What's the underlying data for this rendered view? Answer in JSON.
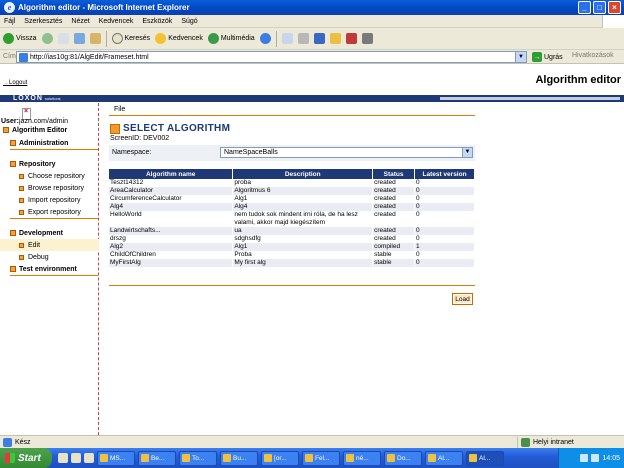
{
  "window": {
    "title": "Algorithm editor - Microsoft Internet Explorer"
  },
  "menubar": [
    "Fájl",
    "Szerkesztés",
    "Nézet",
    "Kedvencek",
    "Eszközök",
    "Súgó"
  ],
  "toolbar": {
    "back": "Vissza",
    "search": "Keresés",
    "favorites": "Kedvencek",
    "media": "Multimédia"
  },
  "address": {
    "label": "Cím",
    "url": "http://ias10g:81/AlgEdit/Frameset.html",
    "go": "Ugrás",
    "links": "Hivatkozások"
  },
  "app": {
    "logout": "Logout",
    "title": "Algorithm editor",
    "brand": "LOXON",
    "brand_sub": "solutions"
  },
  "user": {
    "label": "User:",
    "value": "jazn.com/admin"
  },
  "tree": {
    "root": "Algorithm Editor",
    "groups": [
      {
        "label": "Administration",
        "items": []
      },
      {
        "label": "Repository",
        "items": [
          "Choose repository",
          "Browse repository",
          "Import repository",
          "Export repository"
        ]
      },
      {
        "label": "Development",
        "items": [
          "Edit",
          "Debug"
        ]
      },
      {
        "label": "Test environment",
        "items": []
      }
    ],
    "active_item": "Edit"
  },
  "main": {
    "file_menu": "File",
    "section_title": "SELECT ALGORITHM",
    "screen_id": "ScreenID: DEV002",
    "namespace_label": "Namespace:",
    "namespace_value": "NameSpaceBalls",
    "load_button": "Load"
  },
  "table": {
    "headers": [
      "Algorithm name",
      "Description",
      "Status",
      "Latest version"
    ],
    "rows": [
      [
        "Teszt14312",
        "proba",
        "created",
        "0"
      ],
      [
        "AreaCalculator",
        "Algoritmus 6",
        "created",
        "0"
      ],
      [
        "CircumferenceCalculator",
        "Alg1",
        "created",
        "0"
      ],
      [
        "Alg4",
        "Alg4",
        "created",
        "0"
      ],
      [
        "HelloWorld",
        "nem tudok sok mindent irni róla, de ha lesz valami, akkor majd kiegészítem",
        "created",
        "0"
      ],
      [
        "Landwirtschafts...",
        "ua",
        "created",
        "0"
      ],
      [
        "drszg",
        "sdghsdfg",
        "created",
        "0"
      ],
      [
        "Alg2",
        "Alg1",
        "compiled",
        "1"
      ],
      [
        "ChildOfChildren",
        "Proba",
        "stable",
        "0"
      ],
      [
        "MyFirstAlg",
        "My first alg",
        "stable",
        "0"
      ]
    ]
  },
  "status": {
    "text": "Kész",
    "zone": "Helyi intranet"
  },
  "taskbar": {
    "start": "Start",
    "tasks": [
      "MS...",
      "Be...",
      "To...",
      "Bu...",
      "[or...",
      "Fel...",
      "né...",
      "Do...",
      "Al...",
      "Al..."
    ],
    "clock": "14:05"
  }
}
